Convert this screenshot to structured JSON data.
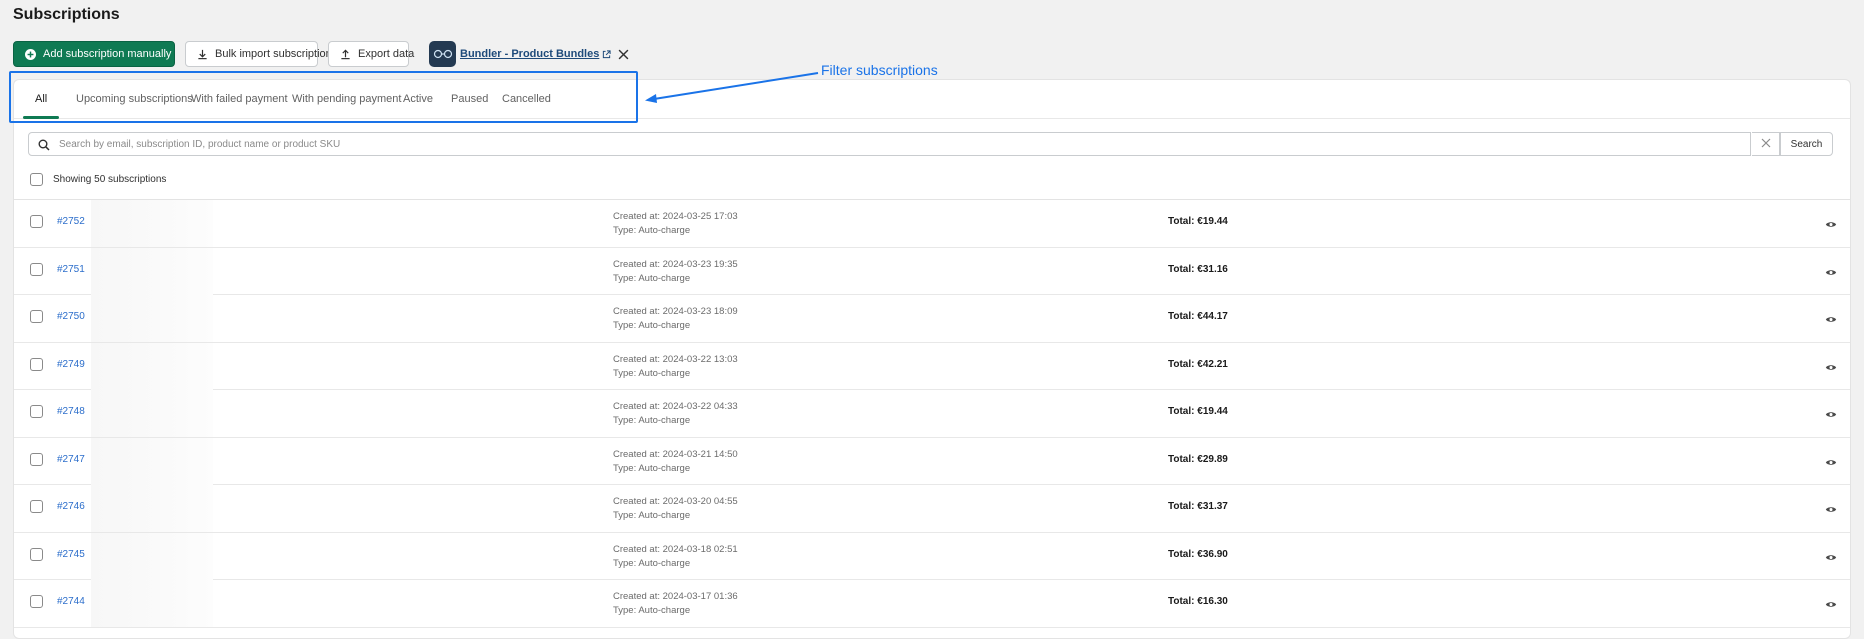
{
  "page": {
    "title": "Subscriptions"
  },
  "toolbar": {
    "add_label": "Add subscription manually",
    "bulk_import_label": "Bulk import subscriptions",
    "export_label": "Export data",
    "app_link_label": "Bundler - Product Bundles"
  },
  "tabs": [
    {
      "label": "All",
      "active": true
    },
    {
      "label": "Upcoming subscriptions",
      "active": false
    },
    {
      "label": "With failed payment",
      "active": false
    },
    {
      "label": "With pending payment",
      "active": false
    },
    {
      "label": "Active",
      "active": false
    },
    {
      "label": "Paused",
      "active": false
    },
    {
      "label": "Cancelled",
      "active": false
    }
  ],
  "annotation": {
    "label": "Filter subscriptions",
    "color": "#1a73e8"
  },
  "search": {
    "placeholder": "Search by email, subscription ID, product name or product SKU",
    "button_label": "Search"
  },
  "list": {
    "count_label": "Showing 50 subscriptions",
    "rows": [
      {
        "id": "#2752",
        "created": "Created at: 2024-03-25 17:03",
        "type": "Type: Auto-charge",
        "total": "Total: €19.44"
      },
      {
        "id": "#2751",
        "created": "Created at: 2024-03-23 19:35",
        "type": "Type: Auto-charge",
        "total": "Total: €31.16"
      },
      {
        "id": "#2750",
        "created": "Created at: 2024-03-23 18:09",
        "type": "Type: Auto-charge",
        "total": "Total: €44.17"
      },
      {
        "id": "#2749",
        "created": "Created at: 2024-03-22 13:03",
        "type": "Type: Auto-charge",
        "total": "Total: €42.21"
      },
      {
        "id": "#2748",
        "created": "Created at: 2024-03-22 04:33",
        "type": "Type: Auto-charge",
        "total": "Total: €19.44"
      },
      {
        "id": "#2747",
        "created": "Created at: 2024-03-21 14:50",
        "type": "Type: Auto-charge",
        "total": "Total: €29.89"
      },
      {
        "id": "#2746",
        "created": "Created at: 2024-03-20 04:55",
        "type": "Type: Auto-charge",
        "total": "Total: €31.37"
      },
      {
        "id": "#2745",
        "created": "Created at: 2024-03-18 02:51",
        "type": "Type: Auto-charge",
        "total": "Total: €36.90"
      },
      {
        "id": "#2744",
        "created": "Created at: 2024-03-17 01:36",
        "type": "Type: Auto-charge",
        "total": "Total: €16.30"
      }
    ]
  },
  "colors": {
    "primary": "#0f7a53",
    "link": "#2c6ecb",
    "annotation": "#1a73e8"
  },
  "icons": [
    "plus-circle-icon",
    "download-icon",
    "upload-icon",
    "app-logo-icon",
    "external-link-icon",
    "close-icon",
    "search-icon",
    "clear-icon",
    "eye-icon",
    "arrow-icon"
  ]
}
